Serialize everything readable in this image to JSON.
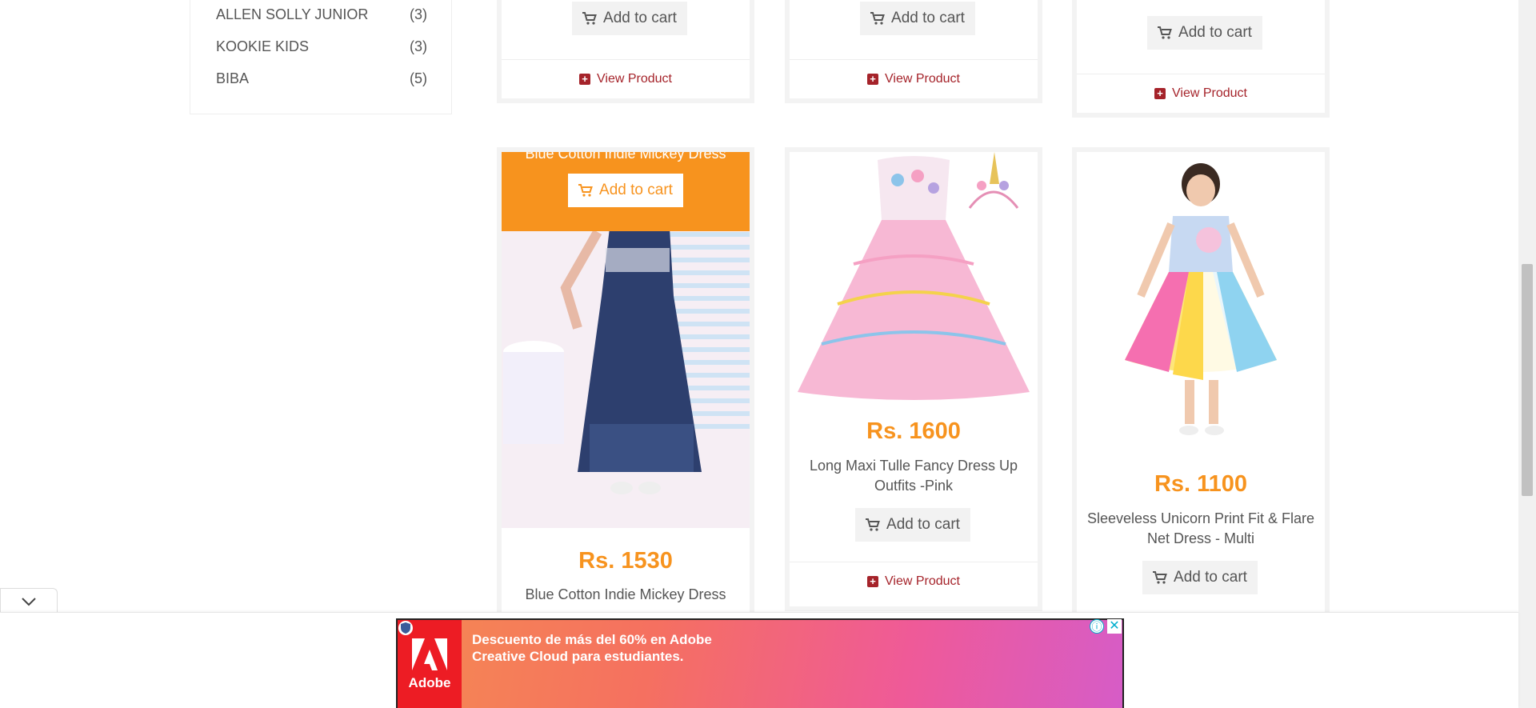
{
  "brands": [
    {
      "name": "ALLEN SOLLY JUNIOR",
      "count": "(3)"
    },
    {
      "name": "KOOKIE KIDS",
      "count": "(3)"
    },
    {
      "name": "BIBA",
      "count": "(5)"
    }
  ],
  "labels": {
    "add_to_cart": "Add to cart",
    "view_product": "View Product"
  },
  "products": [
    {
      "name": "Blue Cotton Indie Mickey Dress",
      "price": "Rs. 1530"
    },
    {
      "name": "Long Maxi Tulle Fancy Dress Up Outfits -Pink",
      "price": "Rs. 1600"
    },
    {
      "name": "Sleeveless Unicorn Print Fit & Flare Net Dress - Multi",
      "price": "Rs. 1100"
    }
  ],
  "ad": {
    "text": "Descuento de más del 60% en Adobe Creative Cloud para estudiantes.",
    "brand": "Adobe",
    "info_glyph": "ⓘ",
    "close_glyph": "✕"
  },
  "colors": {
    "accent": "#f7931e",
    "link": "#a5232a",
    "adobe_red": "#ed1c24"
  }
}
